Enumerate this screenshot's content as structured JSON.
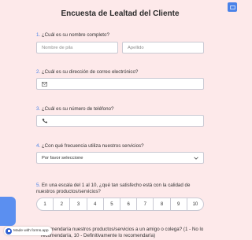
{
  "form": {
    "title": "Encuesta de Lealtad del Cliente",
    "q1": {
      "num": "1.",
      "label": "¿Cuál es su nombre completo?",
      "first_placeholder": "Nombre de pila",
      "last_placeholder": "Apellido"
    },
    "q2": {
      "num": "2.",
      "label": "¿Cuál es su dirección de correo electrónico?",
      "icon": "mail-icon"
    },
    "q3": {
      "num": "3.",
      "label": "¿Cuál es su número de teléfono?",
      "icon": "phone-icon"
    },
    "q4": {
      "num": "4.",
      "label": "¿Con qué frecuencia utiliza nuestros servicios?",
      "select_value": "Por favor seleccione"
    },
    "q5": {
      "num": "5.",
      "label": "En una escala del 1 al 10, ¿qué tan satisfecho está con la calidad de nuestros productos/servicios?",
      "scale": [
        "1",
        "2",
        "3",
        "4",
        "5",
        "6",
        "7",
        "8",
        "9",
        "10"
      ]
    },
    "q6": {
      "label_partial": "recomendaría nuestros productos/servicios a un amigo o colega? (1 - No lo recomendaría, 10 - Definitivamente lo recomendaría)"
    }
  },
  "badge": {
    "text": "Made with forms.app"
  },
  "colors": {
    "background": "#fde9ea",
    "accent": "#4a82e8"
  }
}
